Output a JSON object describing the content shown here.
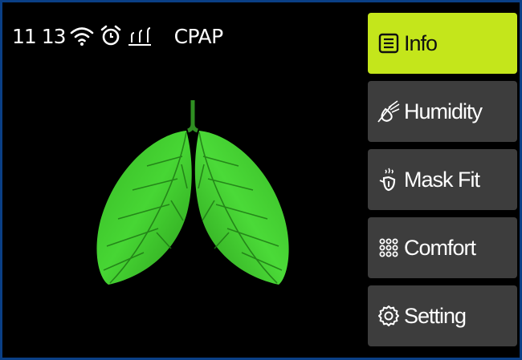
{
  "status_bar": {
    "time": "11 13",
    "mode": "CPAP",
    "icons": [
      "wifi-icon",
      "alarm-clock-icon",
      "humidity-level-icon"
    ]
  },
  "main": {
    "illustration": "lungs-leaf-icon"
  },
  "menu": {
    "items": [
      {
        "label": "Info",
        "icon": "info-list-icon",
        "active": true
      },
      {
        "label": "Humidity",
        "icon": "humidity-icon",
        "active": false
      },
      {
        "label": "Mask Fit",
        "icon": "mask-fit-icon",
        "active": false
      },
      {
        "label": "Comfort",
        "icon": "comfort-grid-icon",
        "active": false
      },
      {
        "label": "Setting",
        "icon": "gear-icon",
        "active": false
      }
    ]
  },
  "colors": {
    "active_button": "#c4e61b",
    "button": "#3d3d3d",
    "frame": "#0a3f86",
    "leaf": "#3fcf2e"
  }
}
